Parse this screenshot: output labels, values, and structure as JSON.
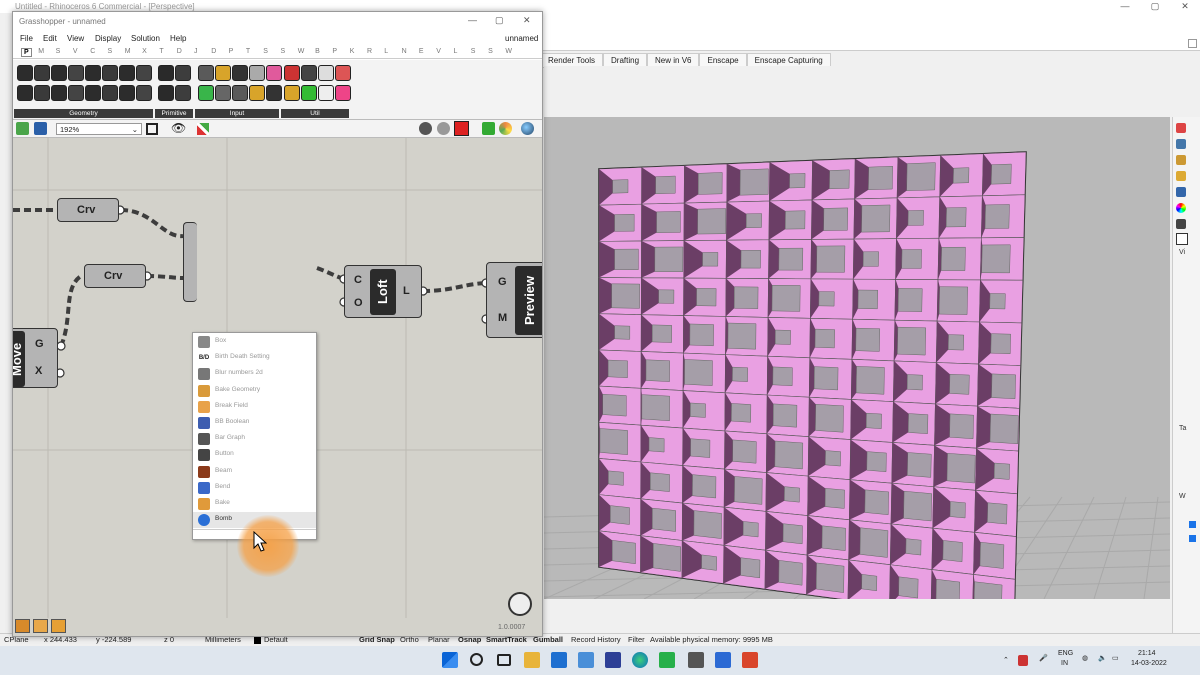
{
  "rhino": {
    "title": "Untitled - Rhinoceros 6 Commercial - [Perspective]",
    "ribbon_tabs": [
      "Render Tools",
      "Drafting",
      "New in V6",
      "Enscape",
      "Enscape Capturing"
    ],
    "right_panel_labels": [
      "Vi",
      "Ta",
      "W"
    ],
    "status": {
      "cplane": "CPlane",
      "x": "x 244.433",
      "y": "y -224.589",
      "z": "z 0",
      "units": "Millimeters",
      "layer": "Default",
      "grid_snap": "Grid Snap",
      "ortho": "Ortho",
      "planar": "Planar",
      "osnap": "Osnap",
      "smarttrack": "SmartTrack",
      "gumball": "Gumball",
      "record_history": "Record History",
      "filter": "Filter",
      "memory": "Available physical memory: 9995 MB"
    }
  },
  "gh": {
    "title": "Grasshopper - unnamed",
    "doc_name": "unnamed",
    "menu": [
      "File",
      "Edit",
      "View",
      "Display",
      "Solution",
      "Help"
    ],
    "tabs": [
      "P",
      "M",
      "S",
      "V",
      "C",
      "S",
      "M",
      "X",
      "T",
      "D",
      "J",
      "D",
      "P",
      "T",
      "S",
      "S",
      "W",
      "B",
      "P",
      "K",
      "R",
      "L",
      "N",
      "E",
      "V",
      "L",
      "S",
      "S",
      "W"
    ],
    "groups": [
      "Geometry",
      "Primitive",
      "Input",
      "Util"
    ],
    "zoom": "192%",
    "version": "1.0.0007",
    "components": {
      "crv1": "Crv",
      "crv2": "Crv",
      "loft": "Loft",
      "loft_in_c": "C",
      "loft_in_o": "O",
      "loft_out": "L",
      "preview": "Preview",
      "preview_in_g": "G",
      "preview_in_m": "M",
      "move": "Move",
      "move_in_g": "G",
      "move_in_x": "X"
    },
    "popup_items": [
      "Box",
      "Birth Death Setting",
      "Blur numbers 2d",
      "Bake Geometry",
      "Break Field",
      "BB Boolean",
      "Bar Graph",
      "Button",
      "Beam",
      "Bend",
      "Bake",
      "Bomb"
    ],
    "popup_icons": [
      "box-icon",
      "birth-death-icon",
      "blur-icon",
      "bake-geometry-icon",
      "break-field-icon",
      "bb-boolean-icon",
      "bar-graph-icon",
      "button-icon",
      "beam-icon",
      "bend-icon",
      "bake-icon",
      "bomb-icon"
    ],
    "popup_icon_text": [
      "",
      "B/D",
      "",
      "",
      "",
      "",
      "",
      "",
      "",
      "",
      "",
      ""
    ],
    "popup_selected": "Bomb"
  },
  "taskbar": {
    "lang_top": "ENG",
    "lang_bottom": "IN",
    "time": "21:14",
    "date": "14-03-2022"
  },
  "colors": {
    "panel_pink": "#e9a0e2",
    "panel_shadow": "#6b3e66",
    "panel_face": "#a59ea8"
  }
}
